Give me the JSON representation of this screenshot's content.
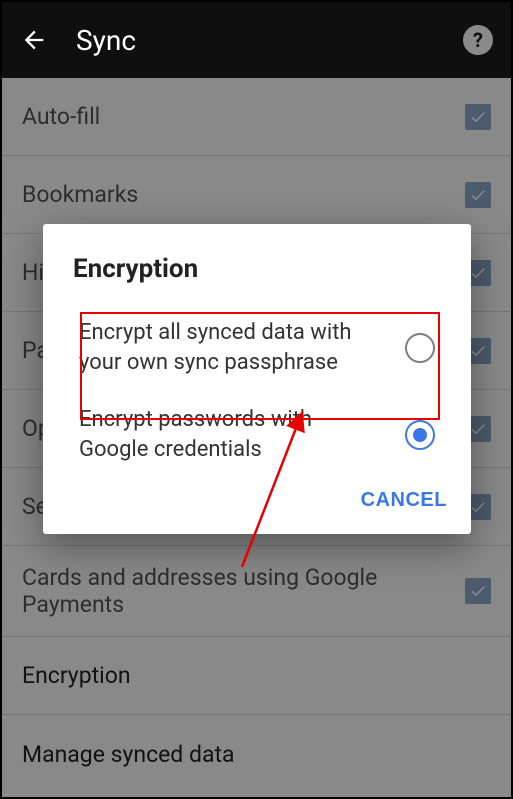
{
  "header": {
    "title": "Sync"
  },
  "settings": {
    "items": [
      {
        "label": "Auto-fill",
        "checked": true
      },
      {
        "label": "Bookmarks",
        "checked": true
      },
      {
        "label": "History",
        "checked": true
      },
      {
        "label": "Passwords",
        "checked": true
      },
      {
        "label": "Open Tabs",
        "checked": true
      },
      {
        "label": "Settings",
        "checked": true
      },
      {
        "label": "Cards and addresses using Google Payments",
        "checked": true
      }
    ],
    "simple": [
      {
        "label": "Encryption"
      },
      {
        "label": "Manage synced data"
      }
    ]
  },
  "dialog": {
    "title": "Encryption",
    "options": [
      {
        "label": "Encrypt all synced data with your own sync passphrase",
        "selected": false
      },
      {
        "label": "Encrypt passwords with Google credentials",
        "selected": true
      }
    ],
    "cancel": "CANCEL"
  }
}
